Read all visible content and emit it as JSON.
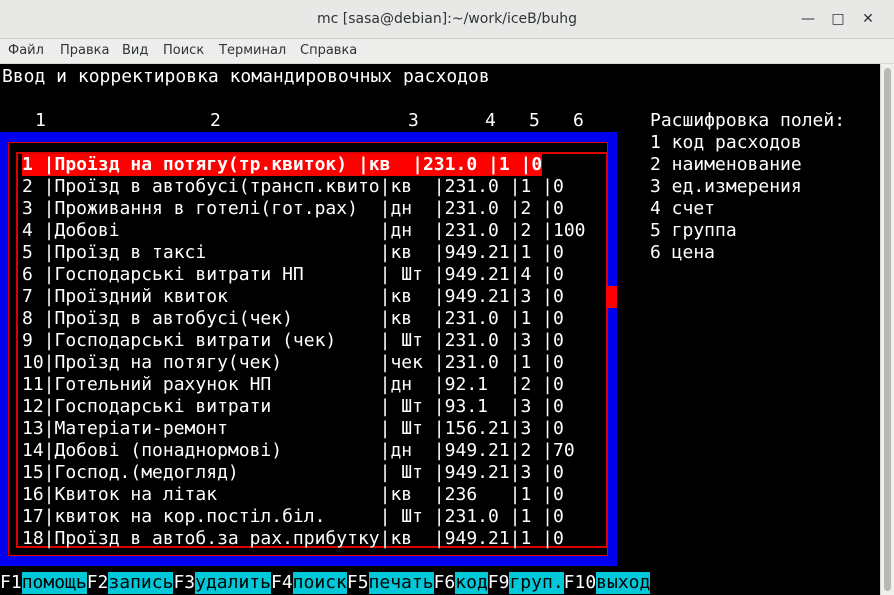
{
  "window": {
    "title": "mc [sasa@debian]:~/work/iceB/buhg"
  },
  "menu": [
    "Файл",
    "Правка",
    "Вид",
    "Поиск",
    "Терминал",
    "Справка"
  ],
  "screen": {
    "heading": "Ввод и корректировка командировочных расходов",
    "column_numbers": [
      "1",
      "2",
      "3",
      "4",
      "5",
      "6"
    ],
    "legend_title": "Расшифровка полей:",
    "legend": [
      "1 код расходов",
      "2 наименование",
      "3 ед.измерения",
      "4 счет",
      "5 группа",
      "6 цена"
    ]
  },
  "rows": [
    "1 |Проїзд на потягу(тр.квиток) |кв  |231.0 |1 |0",
    "2 |Проїзд в автобусі(трансп.квито|кв  |231.0 |1 |0",
    "3 |Проживання в готелі(гот.рах)  |дн  |231.0 |2 |0",
    "4 |Добові                        |дн  |231.0 |2 |100",
    "5 |Проїзд в таксі                |кв  |949.21|1 |0",
    "6 |Господарські витрати НП       | Шт |949.21|4 |0",
    "7 |Проїздний квиток              |кв  |949.21|3 |0",
    "8 |Проїзд в автобусі(чек)        |кв  |231.0 |1 |0",
    "9 |Господарські витрати (чек)    | Шт |231.0 |3 |0",
    "10|Проїзд на потягу(чек)         |чек |231.0 |1 |0",
    "11|Готельний рахунок НП          |дн  |92.1  |2 |0",
    "12|Господарські витрати          | Шт |93.1  |3 |0",
    "13|Матеріати-ремонт              | Шт |156.21|3 |0",
    "14|Добові (понаднормові)         |дн  |949.21|2 |70",
    "15|Господ.(медогляд)             | Шт |949.21|3 |0",
    "16|Квиток на літак               |кв  |236   |1 |0",
    "17|квиток на кор.постіл.біл.     | Шт |231.0 |1 |0",
    "18|Проїзд в автоб.за рах.прибутку|кв  |949.21|1 |0"
  ],
  "fkeys": [
    {
      "key": "F1",
      "label": "помощь"
    },
    {
      "key": "F2",
      "label": "запись"
    },
    {
      "key": "F3",
      "label": "удалить"
    },
    {
      "key": "F4",
      "label": "поиск"
    },
    {
      "key": "F5",
      "label": "печать"
    },
    {
      "key": "F6",
      "label": "код"
    },
    {
      "key": "F9",
      "label": "груп."
    },
    {
      "key": "F10",
      "label": "выход"
    }
  ]
}
